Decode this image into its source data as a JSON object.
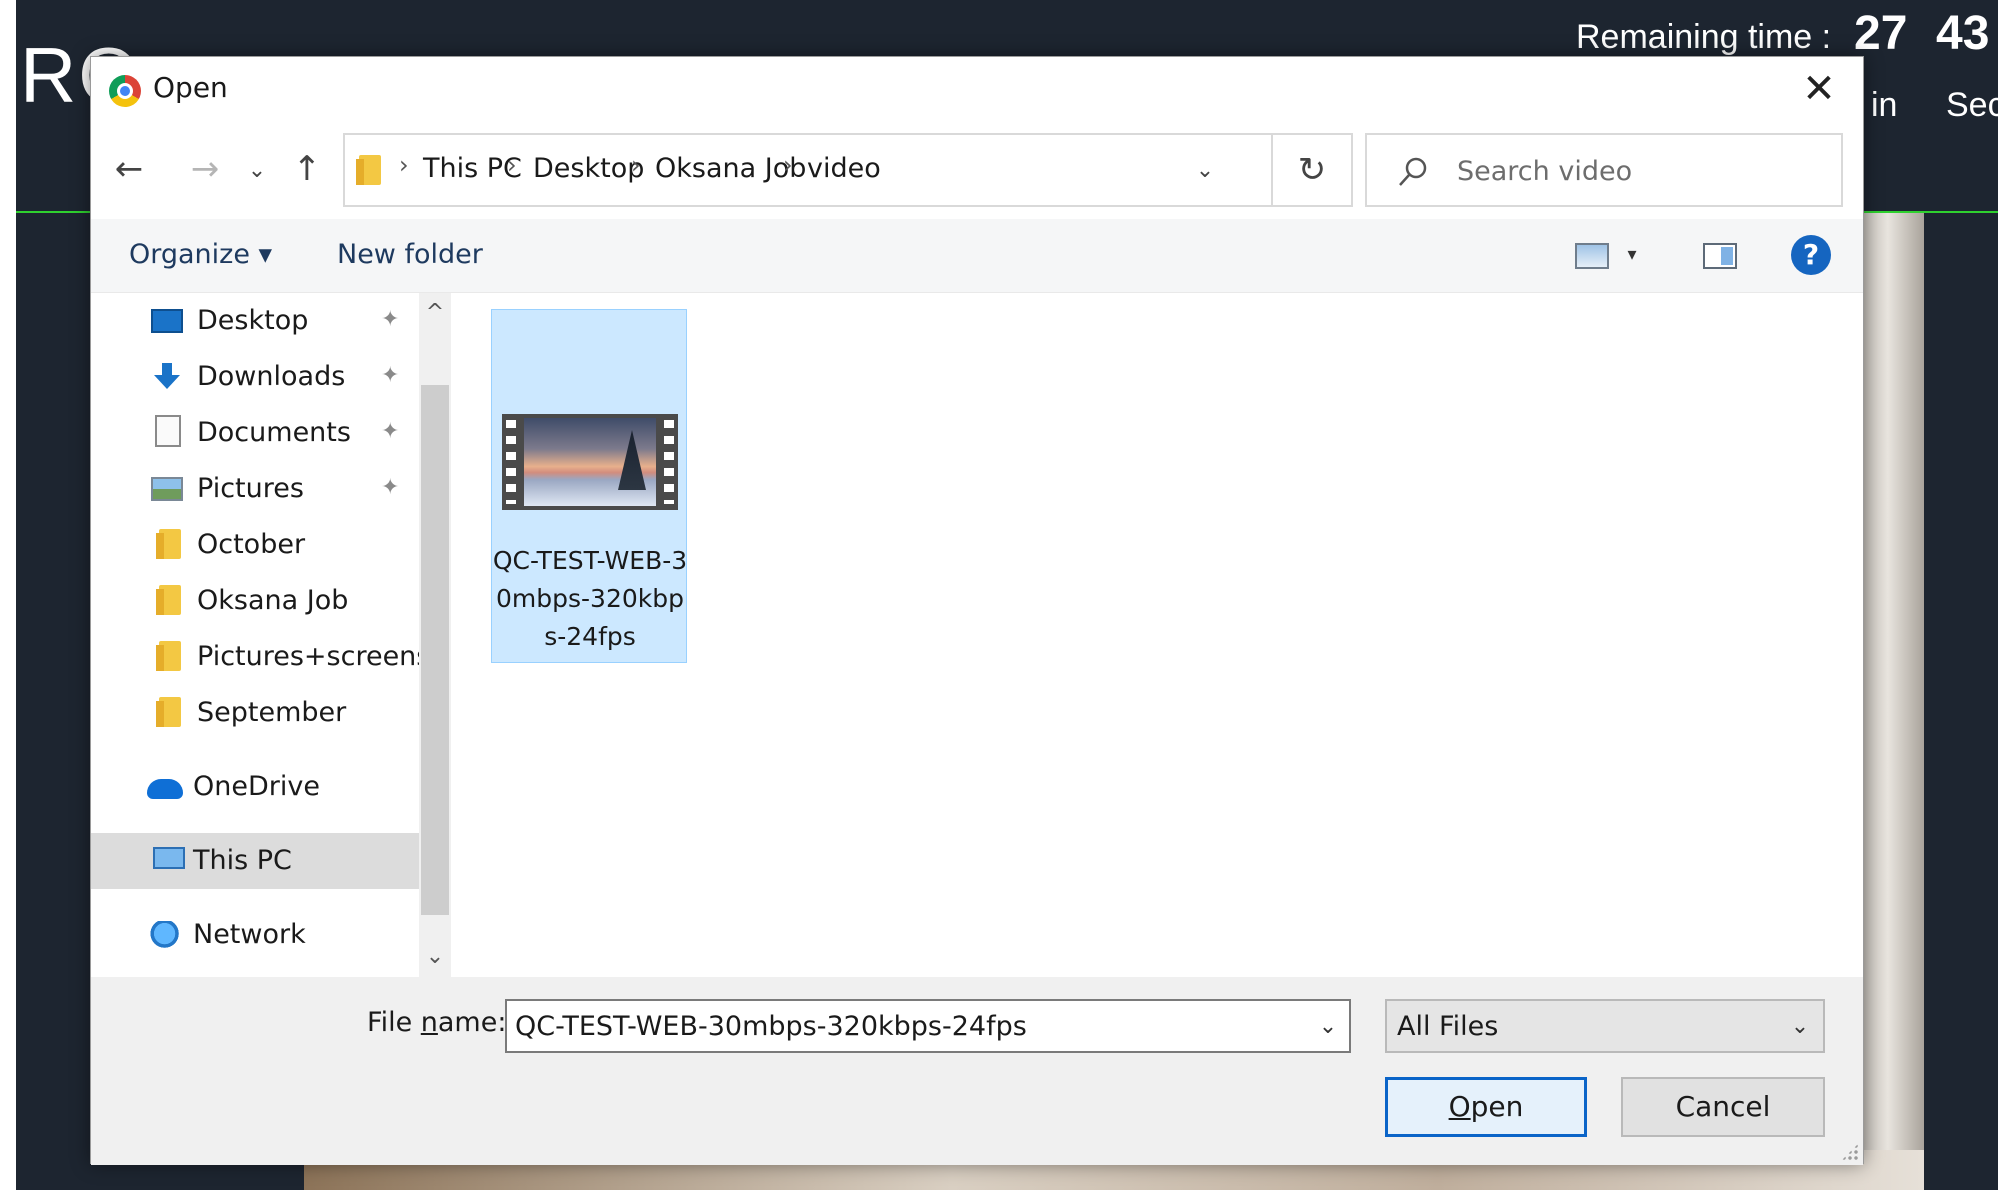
{
  "background_app": {
    "logo_text": "RO",
    "remaining_label": "Remaining time :",
    "minutes_value": "27",
    "seconds_value": "43",
    "minutes_label": "in",
    "seconds_label": "Sec",
    "accent_color": "#2fd12f"
  },
  "dialog": {
    "title": "Open",
    "title_icon": "chrome-icon",
    "close_icon": "close-icon"
  },
  "nav_buttons": {
    "back": "←",
    "forward": "→",
    "recent": "⌄",
    "up": "↑"
  },
  "address": {
    "breadcrumbs": [
      "This PC",
      "Desktop",
      "Oksana Job",
      "video"
    ],
    "separator": "›",
    "dropdown": "⌄",
    "refresh": "↻"
  },
  "search": {
    "placeholder": "Search video",
    "value": ""
  },
  "toolbar": {
    "organize_label": "Organize ▾",
    "new_folder_label": "New folder",
    "view_dropdown": "▾",
    "help_label": "?"
  },
  "nav_pane": {
    "items": [
      {
        "label": "Desktop",
        "icon": "desktop-icon",
        "pinned": true
      },
      {
        "label": "Downloads",
        "icon": "downloads-icon",
        "pinned": true
      },
      {
        "label": "Documents",
        "icon": "documents-icon",
        "pinned": true
      },
      {
        "label": "Pictures",
        "icon": "pictures-icon",
        "pinned": true
      },
      {
        "label": "October",
        "icon": "folder-icon",
        "pinned": false
      },
      {
        "label": "Oksana Job",
        "icon": "folder-icon",
        "pinned": false
      },
      {
        "label": "Pictures+screens",
        "icon": "folder-icon",
        "pinned": false
      },
      {
        "label": "September",
        "icon": "folder-icon",
        "pinned": false
      },
      {
        "label": "OneDrive",
        "icon": "onedrive-icon",
        "pinned": false
      },
      {
        "label": "This PC",
        "icon": "this-pc-icon",
        "pinned": false,
        "selected": true
      },
      {
        "label": "Network",
        "icon": "network-icon",
        "pinned": false
      }
    ],
    "pin_glyph": "📌",
    "scroll_up": "^",
    "scroll_down": "⌄"
  },
  "files": [
    {
      "name": "QC-TEST-WEB-30mbps-320kbps-24fps",
      "type": "video",
      "selected": true
    }
  ],
  "footer": {
    "file_name_label_pre": "File ",
    "file_name_label_accel": "n",
    "file_name_label_post": "ame:",
    "file_name_value": "QC-TEST-WEB-30mbps-320kbps-24fps",
    "file_type": "All Files",
    "dropdown": "⌄",
    "open_label_accel": "O",
    "open_label_rest": "pen",
    "cancel_label": "Cancel"
  }
}
